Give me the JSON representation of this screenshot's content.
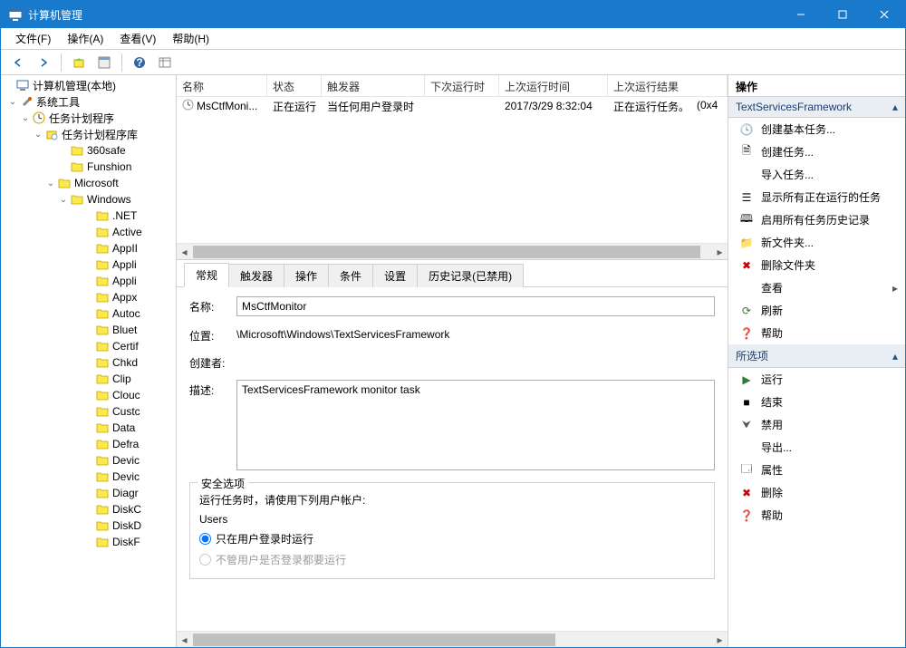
{
  "window": {
    "title": "计算机管理"
  },
  "menu": {
    "file": "文件(F)",
    "action": "操作(A)",
    "view": "查看(V)",
    "help": "帮助(H)"
  },
  "tree": {
    "root": "计算机管理(本地)",
    "sysTools": "系统工具",
    "scheduler": "任务计划程序",
    "library": "任务计划程序库",
    "items": [
      "360safe",
      "Funshion",
      "Microsoft",
      "Windows",
      ".NET",
      "Active",
      "AppII",
      "Appli",
      "Appli",
      "Appx",
      "Autoc",
      "Bluet",
      "Certif",
      "Chkd",
      "Clip",
      "Clouc",
      "Custc",
      "Data",
      "Defra",
      "Devic",
      "Devic",
      "Diagr",
      "DiskC",
      "DiskD",
      "DiskF"
    ]
  },
  "taskColumns": {
    "name": "名称",
    "state": "状态",
    "trigger": "触发器",
    "next": "下次运行时间",
    "last": "上次运行时间",
    "result": "上次运行结果"
  },
  "taskRow": {
    "name": "MsCtfMoni...",
    "state": "正在运行",
    "trigger": "当任何用户登录时",
    "next": "",
    "last": "2017/3/29 8:32:04",
    "result": "正在运行任务。",
    "code": "(0x4"
  },
  "tabs": {
    "general": "常规",
    "triggers": "触发器",
    "actions": "操作",
    "conditions": "条件",
    "settings": "设置",
    "history": "历史记录(已禁用)"
  },
  "detail": {
    "nameLabel": "名称:",
    "nameVal": "MsCtfMonitor",
    "locLabel": "位置:",
    "locVal": "\\Microsoft\\Windows\\TextServicesFramework",
    "authorLabel": "创建者:",
    "authorVal": "",
    "descLabel": "描述:",
    "descVal": "TextServicesFramework monitor task",
    "secTitle": "安全选项",
    "secLine1": "运行任务时，请使用下列用户帐户:",
    "secUser": "Users",
    "radio1": "只在用户登录时运行",
    "radio2": "不管用户是否登录都要运行"
  },
  "panel": {
    "title": "操作",
    "section1": "TextServicesFramework",
    "a1": "创建基本任务...",
    "a2": "创建任务...",
    "a3": "导入任务...",
    "a4": "显示所有正在运行的任务",
    "a5": "启用所有任务历史记录",
    "a6": "新文件夹...",
    "a7": "删除文件夹",
    "a8": "查看",
    "a9": "刷新",
    "a10": "帮助",
    "section2": "所选项",
    "b1": "运行",
    "b2": "结束",
    "b3": "禁用",
    "b4": "导出...",
    "b5": "属性",
    "b6": "删除",
    "b7": "帮助"
  }
}
